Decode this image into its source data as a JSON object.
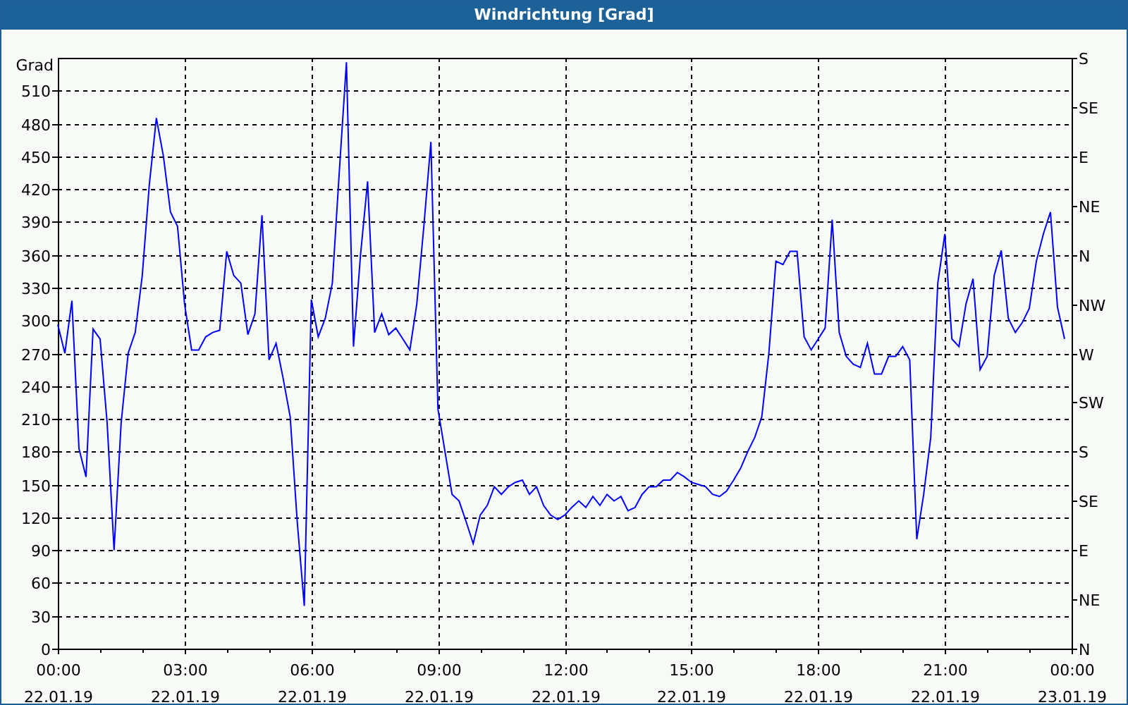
{
  "window": {
    "title": "Windrichtung [Grad]"
  },
  "chart": {
    "chart_data": {
      "type": "line",
      "ylabel": "Grad",
      "categories": [
        "00:00 22.01.19",
        null,
        null,
        null,
        null,
        null,
        null,
        null,
        null,
        null,
        null,
        null,
        null,
        null,
        null,
        null,
        null,
        null,
        "03:00 22.01.19",
        null,
        null,
        null,
        null,
        null,
        null,
        null,
        null,
        null,
        null,
        null,
        null,
        null,
        null,
        null,
        null,
        null,
        "06:00 22.01.19",
        null,
        null,
        null,
        null,
        null,
        null,
        null,
        null,
        null,
        null,
        null,
        null,
        null,
        null,
        null,
        null,
        null,
        "09:00 22.01.19",
        null,
        null,
        null,
        null,
        null,
        null,
        null,
        null,
        null,
        null,
        null,
        null,
        null,
        null,
        null,
        null,
        null,
        "12:00 22.01.19",
        null,
        null,
        null,
        null,
        null,
        null,
        null,
        null,
        null,
        null,
        null,
        null,
        null,
        null,
        null,
        null,
        null,
        "15:00 22.01.19",
        null,
        null,
        null,
        null,
        null,
        null,
        null,
        null,
        null,
        null,
        null,
        null,
        null,
        null,
        null,
        null,
        null,
        "18:00 22.01.19",
        null,
        null,
        null,
        null,
        null,
        null,
        null,
        null,
        null,
        null,
        null,
        null,
        null,
        null,
        null,
        null,
        null,
        "21:00 22.01.19",
        null,
        null,
        null,
        null,
        null,
        null,
        null,
        null,
        null,
        null,
        null,
        null,
        null,
        null,
        null,
        null,
        null,
        "00:00 23.01.19"
      ],
      "series": [
        {
          "color": "#0000ff",
          "values": [
            296,
            270,
            318,
            183,
            157,
            292,
            283,
            206,
            90,
            206,
            270,
            289,
            341,
            424,
            485,
            450,
            399,
            386,
            315,
            273,
            273,
            285,
            289,
            291,
            363,
            341,
            334,
            287,
            306,
            396,
            264,
            279,
            247,
            212,
            116,
            39,
            319,
            285,
            302,
            334,
            437,
            536,
            276,
            360,
            427,
            289,
            306,
            287,
            293,
            283,
            273,
            315,
            386,
            463,
            219,
            180,
            141,
            135,
            116,
            96,
            122,
            131,
            148,
            141,
            148,
            152,
            154,
            141,
            148,
            131,
            122,
            118,
            122,
            129,
            135,
            129,
            139,
            131,
            141,
            135,
            139,
            126,
            129,
            141,
            148,
            148,
            154,
            154,
            161,
            157,
            152,
            150,
            148,
            141,
            139,
            144,
            154,
            165,
            180,
            193,
            212,
            270,
            354,
            351,
            363,
            363,
            285,
            273,
            283,
            293,
            392,
            289,
            267,
            260,
            257,
            279,
            251,
            251,
            267,
            267,
            276,
            264,
            100,
            141,
            193,
            334,
            379,
            283,
            276,
            315,
            338,
            255,
            267,
            341,
            364,
            302,
            289,
            298,
            311,
            354,
            379,
            399,
            312,
            283,
            null
          ]
        }
      ],
      "grid": true,
      "ylim": [
        0,
        540
      ],
      "yticks": [
        0,
        30,
        60,
        90,
        120,
        150,
        180,
        210,
        240,
        270,
        300,
        330,
        360,
        390,
        420,
        450,
        480,
        510
      ]
    },
    "right_axis_labels": [
      "S",
      "SE",
      "E",
      "NE",
      "N",
      "NW",
      "W",
      "SW",
      "S",
      "SE",
      "E",
      "NE",
      "N"
    ]
  }
}
